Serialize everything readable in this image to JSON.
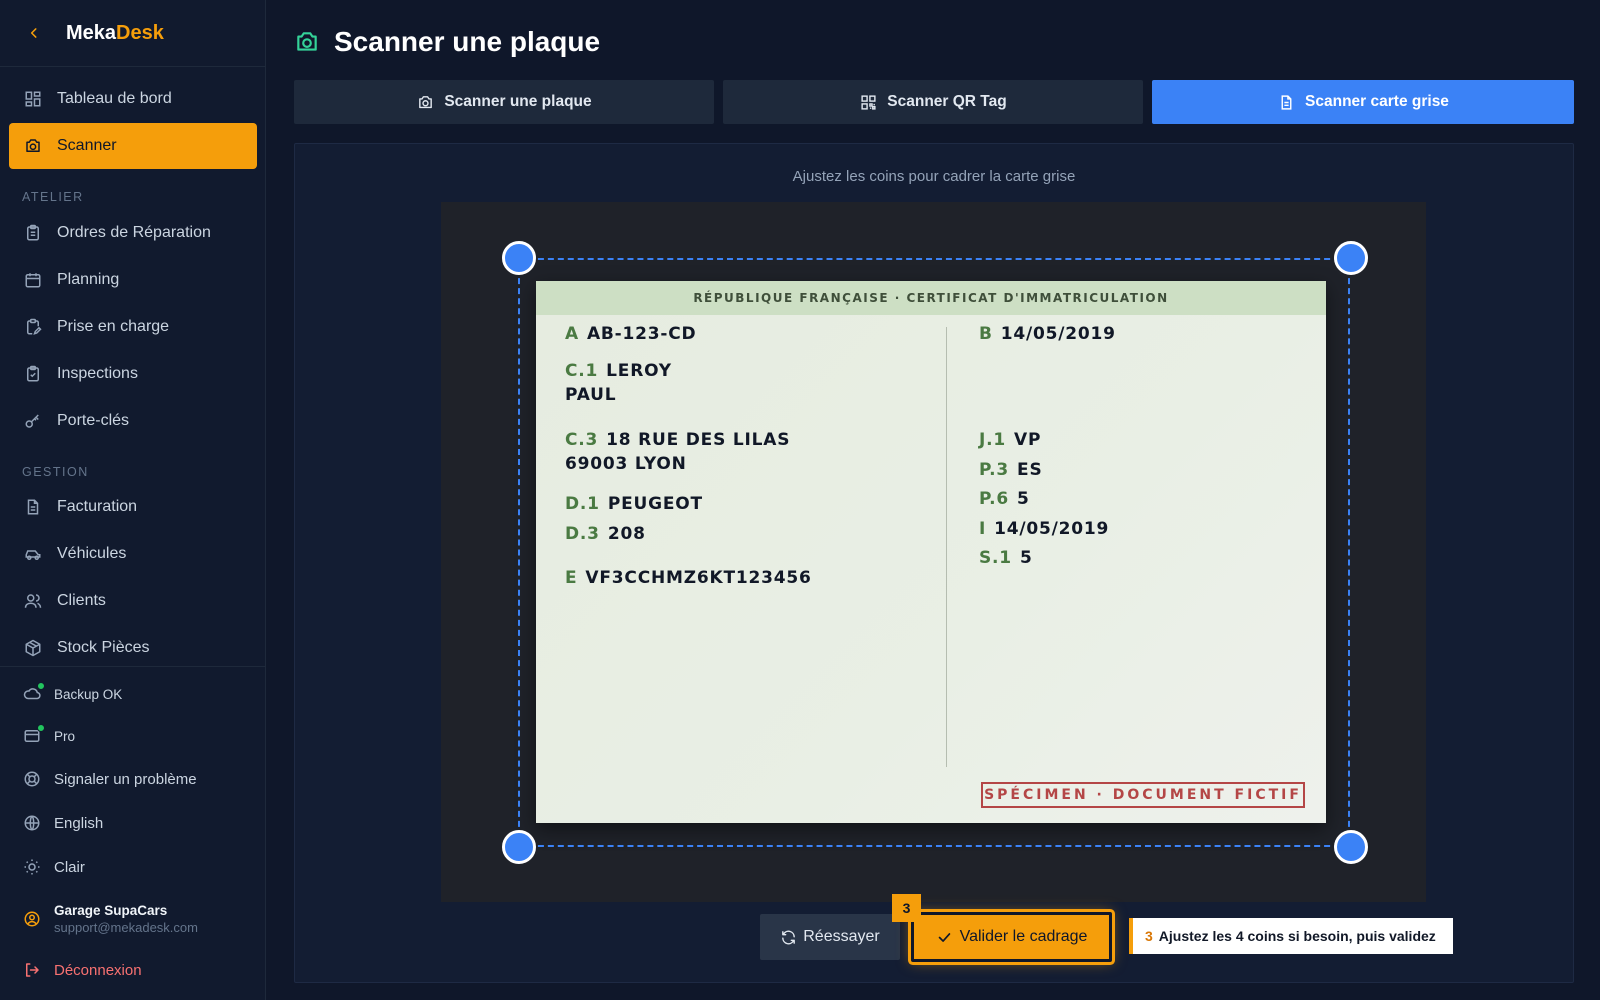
{
  "app": {
    "brand_main": "Meka",
    "brand_accent": "Desk"
  },
  "sidebar": {
    "main_items": [
      {
        "label": "Tableau de bord",
        "icon": "dashboard-icon"
      },
      {
        "label": "Scanner",
        "icon": "camera-icon",
        "active": true
      }
    ],
    "atelier_label": "ATELIER",
    "atelier_items": [
      {
        "label": "Ordres de Réparation",
        "icon": "clipboard-icon"
      },
      {
        "label": "Planning",
        "icon": "calendar-icon"
      },
      {
        "label": "Prise en charge",
        "icon": "clipboard-pen-icon"
      },
      {
        "label": "Inspections",
        "icon": "clipboard-check-icon"
      },
      {
        "label": "Porte-clés",
        "icon": "key-icon"
      }
    ],
    "gestion_label": "GESTION",
    "gestion_items": [
      {
        "label": "Facturation",
        "icon": "file-text-icon"
      },
      {
        "label": "Véhicules",
        "icon": "car-icon"
      },
      {
        "label": "Clients",
        "icon": "users-icon"
      },
      {
        "label": "Stock Pièces",
        "icon": "package-icon"
      }
    ],
    "footer": {
      "backup": "Backup OK",
      "plan": "Pro",
      "report": "Signaler un problème",
      "language": "English",
      "theme": "Clair",
      "account_name": "Garage SupaCars",
      "account_email": "support@mekadesk.com",
      "logout": "Déconnexion"
    }
  },
  "page": {
    "title": "Scanner une plaque"
  },
  "tabs": [
    {
      "label": "Scanner une plaque",
      "icon": "camera-icon",
      "active": false
    },
    {
      "label": "Scanner QR Tag",
      "icon": "qr-code-icon",
      "active": false
    },
    {
      "label": "Scanner carte grise",
      "icon": "file-text-icon",
      "active": true
    }
  ],
  "scan": {
    "hint": "Ajustez les coins pour cadrer la carte grise",
    "document": {
      "header": "RÉPUBLIQUE FRANÇAISE · CERTIFICAT D'IMMATRICULATION",
      "fields": {
        "A": "AB-123-CD",
        "C1_line1": "LEROY",
        "C1_line2": "PAUL",
        "C3_line1": "18 RUE DES LILAS",
        "C3_line2": "69003 LYON",
        "D1": "PEUGEOT",
        "D3": "208",
        "E": "VF3CCHMZ6KT123456",
        "B": "14/05/2019",
        "J1": "VP",
        "P3": "ES",
        "P6": "5",
        "I": "14/05/2019",
        "S1": "5"
      },
      "keys": {
        "A": "A",
        "C1": "C.1",
        "C3": "C.3",
        "D1": "D.1",
        "D3": "D.3",
        "E": "E",
        "B": "B",
        "J1": "J.1",
        "P3": "P.3",
        "P6": "P.6",
        "I": "I",
        "S1": "S.1"
      },
      "stamp": "SPÉCIMEN · DOCUMENT FICTIF"
    },
    "retry_label": "Réessayer",
    "validate_label": "Valider le cadrage",
    "step_number": "3",
    "tooltip_step": "3",
    "tooltip_text": "Ajustez les 4 coins si besoin, puis validez"
  },
  "colors": {
    "accent": "#f59e0b",
    "primary": "#3b82f6",
    "success": "#22c55e",
    "danger": "#f87171"
  }
}
